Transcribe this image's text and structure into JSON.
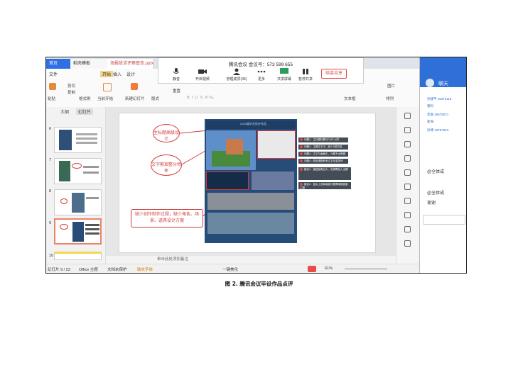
{
  "window": {
    "tabs": [
      "首页",
      "稻壳模板",
      "海报設活评察基信.pptx"
    ],
    "menu": [
      "文件",
      "开始",
      "插入",
      "设计"
    ],
    "ribbon": [
      "粘贴",
      "剪切",
      "复制",
      "格式刷",
      "当前开始",
      "新建幻灯片",
      "版式",
      "重置",
      "图片",
      "文本框",
      "排列"
    ],
    "zoom": "61%"
  },
  "meeting": {
    "title": "腾讯会议 会议号：573 599 655",
    "buttons": [
      "静音",
      "开启视频",
      "管理成员(35)",
      "更多",
      "共享屏幕",
      "暂停共享"
    ],
    "end": "结束共享"
  },
  "left_panel": {
    "tabs": [
      "大纲",
      "幻灯片"
    ],
    "slides": [
      "6",
      "7",
      "8",
      "9",
      "10"
    ],
    "selected": "9"
  },
  "slide": {
    "poster_title": "2020届毕业设计作品",
    "callouts": [
      "主标题高级设计",
      "文字繁琐整分师率",
      "缺少创作制作过程，缺少角色、场景、道具设计方案"
    ],
    "notes": [
      "问题1：主标题标题与CMD 对齐",
      "问题2：主题文字中，缺少A层内容",
      "问题3：文字与画面中，元素不太明确",
      "问题4：颜色搭配和有文字在重排列",
      "建议1：缩进距离过大，色调需加入主题",
      "建议2：复杂上选择画面元素需增强面重主题"
    ]
  },
  "status": {
    "page": "幻灯片 9 / 23",
    "theme": "Office 主题",
    "protect": "文档未保护",
    "font": "缺失字体",
    "beautify": "一键美化",
    "notes_hint": "单击此处添加备注"
  },
  "chat": {
    "title": "聊天",
    "messages": [
      "孙建平 15373118",
      "蔡利",
      "李丽 18575071",
      "崔海",
      "孙博 13787024",
      "@全体成",
      "@全体成",
      "谢谢"
    ]
  },
  "caption": "图 2. 腾讯会议毕设作品点评",
  "colors": {
    "accent": "#2f6fe4",
    "callout": "#d23c3c",
    "poster": "#274c78"
  }
}
